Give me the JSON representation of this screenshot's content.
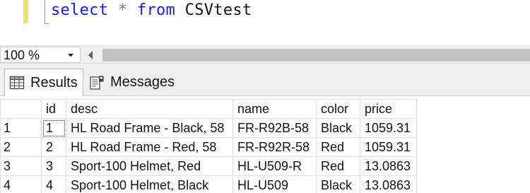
{
  "editor": {
    "query_keyword_select": "select",
    "query_star": "*",
    "query_keyword_from": "from",
    "query_table": "CSVtest",
    "keyword_color": "#1818ff",
    "change_marker_color": "#f2e26c"
  },
  "zoom": {
    "value": "100 %"
  },
  "tabs": {
    "results_label": "Results",
    "messages_label": "Messages",
    "active": "Results"
  },
  "grid": {
    "columns": [
      "id",
      "desc",
      "name",
      "color",
      "price"
    ],
    "rows": [
      {
        "row": "1",
        "id": "1",
        "desc": "HL Road Frame - Black, 58",
        "name": "FR-R92B-58",
        "color": "Black",
        "price": "1059.31"
      },
      {
        "row": "2",
        "id": "2",
        "desc": "HL Road Frame - Red, 58",
        "name": "FR-R92R-58",
        "color": "Red",
        "price": "1059.31"
      },
      {
        "row": "3",
        "id": "3",
        "desc": "Sport-100 Helmet, Red",
        "name": "HL-U509-R",
        "color": "Red",
        "price": "13.0863"
      },
      {
        "row": "4",
        "id": "4",
        "desc": "Sport-100 Helmet, Black",
        "name": "HL-U509",
        "color": "Black",
        "price": "13.0863"
      }
    ]
  }
}
